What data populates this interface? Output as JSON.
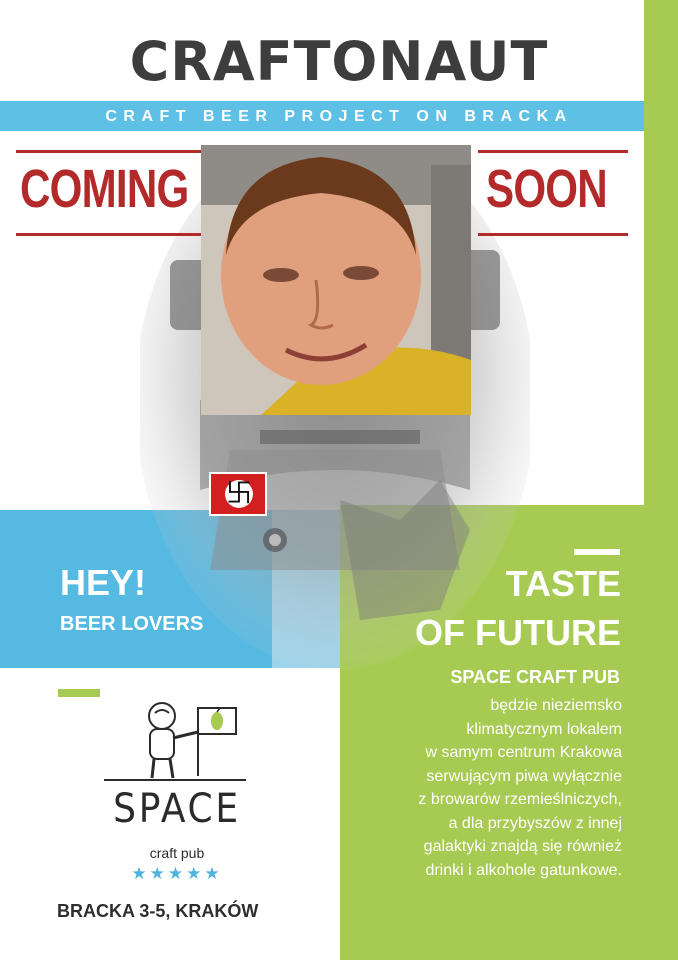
{
  "header": {
    "title": "CRAFTONAUT",
    "subtitle": "CRAFT BEER PROJECT ON BRACKA"
  },
  "banner": {
    "left_word": "COMING",
    "right_word": "SOON"
  },
  "hey_block": {
    "headline": "HEY!",
    "subline": "BEER LOVERS"
  },
  "taste_block": {
    "line1": "TASTE",
    "line2": "OF FUTURE",
    "pub_name": "SPACE CRAFT PUB",
    "description": [
      "będzie nieziemsko",
      "klimatycznym lokalem",
      "w samym centrum Krakowa",
      "serwującym piwa wyłącznie",
      "z browarów rzemieślniczych,",
      "a dla przybyszów z innej",
      "galaktyki znajdą się również",
      "drinki i alkohole gatunkowe."
    ]
  },
  "logo": {
    "name": "SPACE",
    "tagline": "craft pub",
    "stars": "★★★★★",
    "address": "BRACKA 3-5, KRAKÓW"
  },
  "emblem": {
    "glyph": "卐"
  },
  "colors": {
    "blue": "#55b9e2",
    "green": "#a7cb52",
    "red": "#b22a2a",
    "dark": "#3d3d3d"
  },
  "icons": [
    "astronaut-illustration",
    "astronaut-logo-icon",
    "hop-flag-icon",
    "portrait-photo",
    "flag-emblem"
  ]
}
